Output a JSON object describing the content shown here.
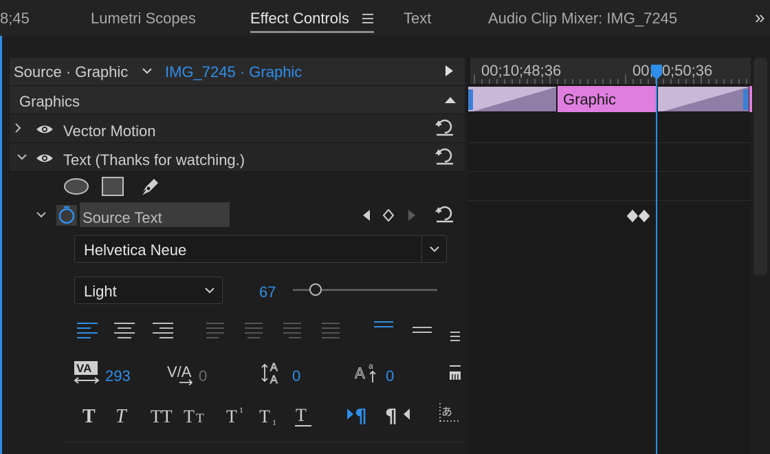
{
  "tabs": {
    "timecode_fragment": "8;45",
    "lumetri": "Lumetri Scopes",
    "effect_controls": "Effect Controls",
    "text": "Text",
    "audio_mixer": "Audio Clip Mixer: IMG_7245",
    "more_glyph": "»"
  },
  "source": {
    "label": "Source · Graphic",
    "clip": "IMG_7245 · Graphic"
  },
  "sections": {
    "graphics": "Graphics",
    "vector_motion": "Vector Motion",
    "text_layer": "Text (Thanks for watching.)",
    "source_text": "Source Text"
  },
  "font": {
    "family": "Helvetica Neue",
    "style": "Light",
    "size": "67",
    "size_slider_fraction": 0.16
  },
  "metrics": {
    "tracking": "293",
    "kerning": "0",
    "leading": "0",
    "baseline_shift": "0"
  },
  "timeline": {
    "tc_left": "00;10;48;36",
    "tc_right": "00;10;50;36",
    "clip_label": "Graphic"
  },
  "colors": {
    "accent_blue": "#2f8ee8",
    "clip_pink": "#e07ee0",
    "clip_lavender": "#c9b8d8"
  },
  "icons": [
    "chevron-right-icon",
    "chevron-down-icon",
    "eye-icon",
    "reset-icon",
    "ellipse-tool-icon",
    "rectangle-tool-icon",
    "pen-tool-icon",
    "stopwatch-icon",
    "keyframe-prev-icon",
    "keyframe-add-icon",
    "keyframe-next-icon",
    "align-left-icon",
    "align-center-icon",
    "align-right-icon",
    "justify-icon",
    "hamburger-icon",
    "tracking-icon",
    "kerning-icon",
    "leading-icon",
    "baseline-shift-icon",
    "bold-icon",
    "italic-icon",
    "all-caps-icon",
    "small-caps-icon",
    "superscript-icon",
    "subscript-icon",
    "underline-icon",
    "ltr-icon",
    "rtl-icon",
    "tsume-icon",
    "play-triangle-icon",
    "playhead-icon"
  ]
}
